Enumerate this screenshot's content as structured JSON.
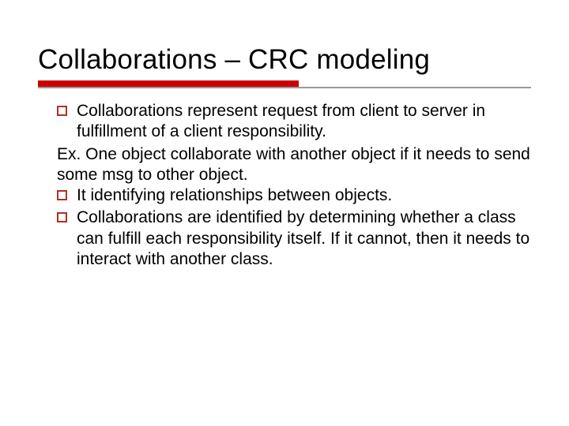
{
  "title": "Collaborations – CRC modeling",
  "items": [
    {
      "kind": "bullet",
      "text": "Collaborations represent request from client to server in fulfillment of a client responsibility."
    },
    {
      "kind": "plain",
      "text": "Ex. One object collaborate with another object if it needs to send some msg to other object."
    },
    {
      "kind": "bullet",
      "text": "It identifying relationships between objects."
    },
    {
      "kind": "bullet",
      "text": "Collaborations are identified by determining whether a class can fulfill each responsibility itself. If it cannot, then it needs to interact with another class."
    }
  ]
}
